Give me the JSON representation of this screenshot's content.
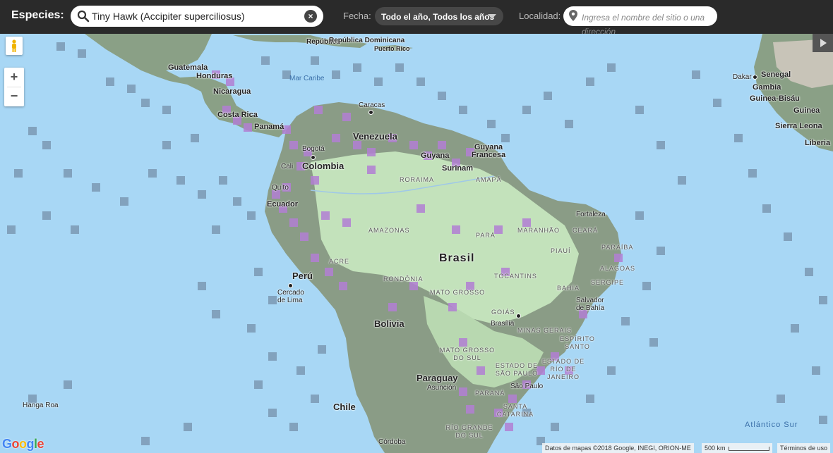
{
  "header": {
    "species_label": "Especies:",
    "species_value": "Tiny Hawk (Accipiter superciliosus)",
    "date_label": "Fecha:",
    "date_value": "Todo el año, Todos los años",
    "location_label": "Localidad:",
    "location_placeholder": "Ingresa el nombre del sitio o una dirección"
  },
  "map": {
    "countries": {
      "guatemala": "Guatemala",
      "honduras": "Honduras",
      "nicaragua": "Nicaragua",
      "costa_rica": "Costa Rica",
      "panama": "Panamá",
      "colombia": "Colombia",
      "venezuela": "Venezuela",
      "guyana": "Guyana",
      "surinam": "Surinam",
      "guyana_francesa": "Guyana Francesa",
      "ecuador": "Ecuador",
      "peru": "Perú",
      "bolivia": "Bolivia",
      "brasil": "Brasil",
      "paraguay": "Paraguay",
      "chile": "Chile",
      "dominicana": "República Dominicana",
      "puerto_rico": "Puerto Rico",
      "senegal": "Senegal",
      "gambia": "Gambia",
      "guinea_bisau": "Guinea-Bisáu",
      "guinea": "Guinea",
      "sierra_leona": "Sierra Leona",
      "liberia": "Liberia"
    },
    "cities": {
      "caracas": "Caracas",
      "bogota": "Bogotá",
      "cali": "Cali",
      "quito": "Quito",
      "lima": "Cercado de Lima",
      "brasilia": "Brasília",
      "salvador": "Salvador de Bahía",
      "fortaleza": "Fortaleza",
      "sao_paulo": "São Paulo",
      "asuncion": "Asunción",
      "cordoba": "Córdoba",
      "dakar": "Dakar"
    },
    "regions": {
      "roraima": "RORAIMA",
      "amapa": "AMAPÁ",
      "amazonas": "AMAZONAS",
      "para": "PARÁ",
      "maranhao": "MARANHÃO",
      "ceara": "CEARÁ",
      "piaui": "PIAUÍ",
      "paraiba": "PARAÍBA",
      "alagoas": "ALAGOAS",
      "sergipe": "SERGIPE",
      "acre": "ACRE",
      "rondonia": "RONDÔNIA",
      "tocantins": "TOCANTINS",
      "mato_grosso": "MATO GROSSO",
      "bahia": "BAHÍA",
      "goias": "GOIÁS",
      "minas_gerais": "MINAS GERAIS",
      "espirito_santo": "ESPÍRITO SANTO",
      "mato_grosso_sul": "MATO GROSSO DO SUL",
      "rio_janeiro": "ESTADO DE RÍO DE JANEIRO",
      "estado_sp": "ESTADO DE SÃO PAULO",
      "parana": "PARANÁ",
      "santa_catarina": "SANTA CATARINA",
      "rio_grande_sul": "RÍO GRANDE DO SUL",
      "hanga_roa": "Hanga Roa"
    },
    "seas": {
      "caribe": "Mar Caribe",
      "atlantico": "Atlántico Sur"
    }
  },
  "footer": {
    "logo": "Google",
    "attribution": "Datos de mapas ©2018 Google, INEGI, ORION-ME",
    "scale": "500 km",
    "terms": "Términos de uso"
  },
  "colors": {
    "ocean": "#a8d7f5",
    "grid_cell": "#7c99b4",
    "forest": "#c8e6c0",
    "land": "#8a9c86",
    "occurrence": "#b27fd4"
  }
}
